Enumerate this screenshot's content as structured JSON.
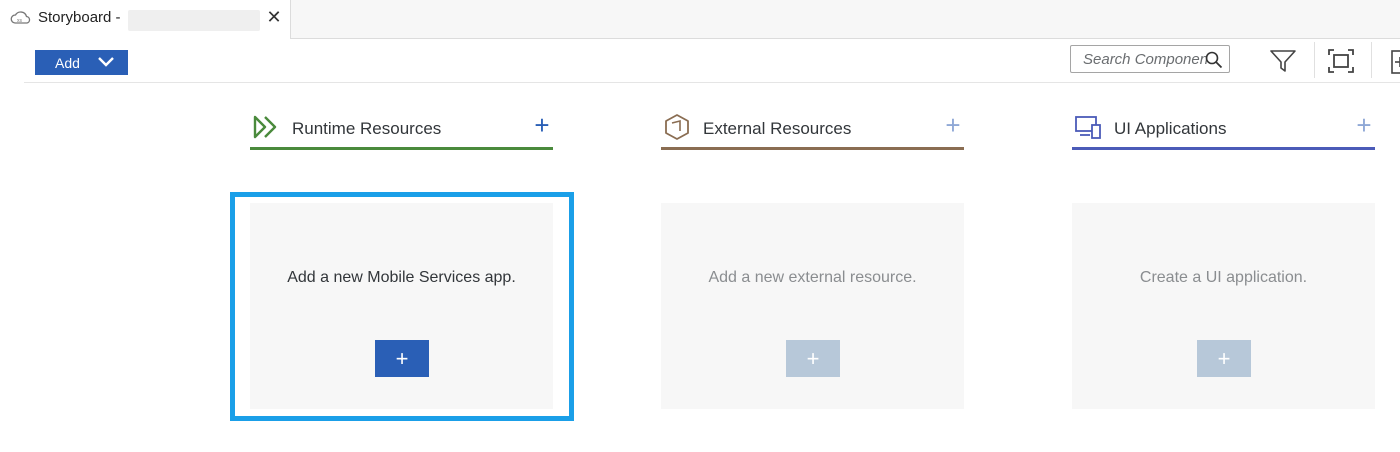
{
  "tab": {
    "icon": "cloud-icon",
    "title": "Storyboard -",
    "close": "✕"
  },
  "toolbar": {
    "add_label": "Add",
    "search_placeholder": "Search Componen",
    "icons": [
      "chevron-down-icon",
      "search-icon",
      "filter-icon",
      "fit-to-screen-icon",
      "add-box-icon"
    ]
  },
  "columns": [
    {
      "title": "Runtime Resources",
      "icon": "double-chevron-icon",
      "accent": "#4a8a3c",
      "plus": "+",
      "card_text": "Add a new Mobile Services app.",
      "card_button": "+",
      "enabled": true
    },
    {
      "title": "External Resources",
      "icon": "cube-icon",
      "accent": "#8a6d52",
      "plus": "+",
      "card_text": "Add a new external resource.",
      "card_button": "+",
      "enabled": false
    },
    {
      "title": "UI Applications",
      "icon": "devices-icon",
      "accent": "#4b5bb8",
      "plus": "+",
      "card_text": "Create a UI application.",
      "card_button": "+",
      "enabled": false
    }
  ],
  "colors": {
    "primary": "#2a5fb6",
    "disabled_button": "#b7c8d9",
    "highlight": "#1a9fe8"
  }
}
